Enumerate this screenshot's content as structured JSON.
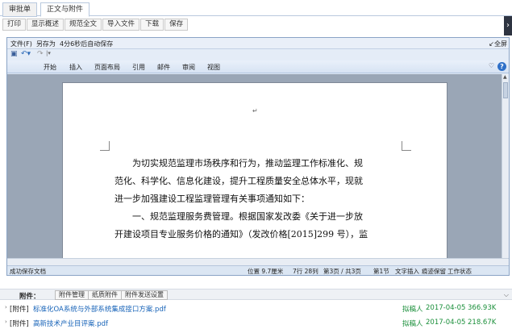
{
  "tabs": [
    {
      "label": "审批单",
      "active": false
    },
    {
      "label": "正文与附件",
      "active": true
    }
  ],
  "toolbar": {
    "print": "打印",
    "show_summary": "显示概述",
    "normalize": "规范全文",
    "import": "导入文件",
    "download": "下载",
    "save": "保存"
  },
  "editor": {
    "file_menu": "文件(F)",
    "save_as": "另存为",
    "autosave": "4分6秒后自动保存",
    "fullscreen": "全屏",
    "ribbon_tabs": [
      "开始",
      "插入",
      "页面布局",
      "引用",
      "邮件",
      "审阅",
      "视图"
    ],
    "body": {
      "line1": "为切实规范监理市场秩序和行为，推动监理工作标准化、规",
      "line2": "范化、科学化、信息化建设，提升工程质量安全总体水平，现就",
      "line3": "进一步加强建设工程监理管理有关事项通知如下：",
      "line4": "一、规范监理服务费管理。根据国家发改委《关于进一步放",
      "line5": "开建设项目专业服务价格的通知》（发改价格[2015]299 号），监"
    },
    "status": {
      "saved": "成功保存文档",
      "position": "位置 9.7厘米",
      "line_col": "7行 28列",
      "page": "第3页 / 共3页",
      "section": "第1节",
      "text_insert": "文字插入",
      "track": "痕迹保留",
      "work_state": "工作状态"
    }
  },
  "attachments": {
    "title": "附件：",
    "buttons": {
      "manage": "附件管理",
      "paper": "纸质附件",
      "send_settings": "附件发送设置"
    },
    "items": [
      {
        "prefix": "[附件]",
        "name": "标准化OA系统与外部系统集成接口方案.pdf",
        "author": "拟稿人",
        "date": "2017-04-05",
        "size": "366.93K"
      },
      {
        "prefix": "[附件]",
        "name": "高新技术产业目评案.pdf",
        "author": "拟稿人",
        "date": "2017-04-05",
        "size": "218.67K"
      }
    ]
  },
  "colors": {
    "link": "#1763b8",
    "meta_green": "#1a8f3a",
    "editor_frame": "#8aa4c6"
  }
}
